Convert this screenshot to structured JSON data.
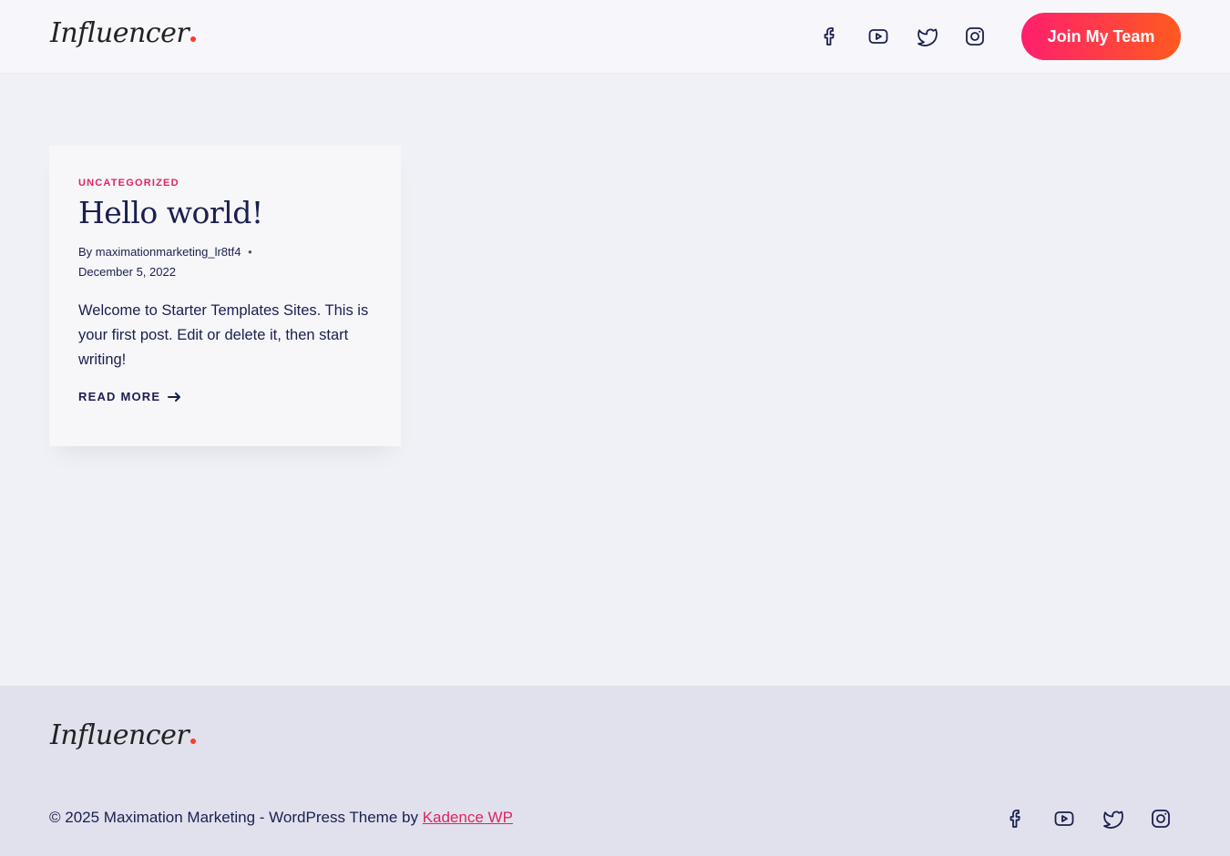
{
  "colors": {
    "accent": "#e0245e",
    "navy": "#1a1f4f",
    "button_gradient_start": "#ff1f6d",
    "button_gradient_end": "#ff5a1f",
    "logo_dot": "#ff3d1f"
  },
  "header": {
    "logo_text": "Influencer",
    "social_icons": [
      "facebook-icon",
      "youtube-icon",
      "twitter-icon",
      "instagram-icon"
    ],
    "cta_label": "Join My Team"
  },
  "post": {
    "category": "UNCATEGORIZED",
    "title": "Hello world!",
    "author_prefix": "By",
    "author": "maximationmarketing_lr8tf4",
    "date": "December 5, 2022",
    "excerpt": "Welcome to Starter Templates Sites. This is your first post. Edit or delete it, then start writing!",
    "read_more": "READ MORE"
  },
  "footer": {
    "logo_text": "Influencer",
    "copyright": "© 2025 Maximation Marketing - WordPress Theme by",
    "theme_link": "Kadence WP",
    "social_icons": [
      "facebook-icon",
      "youtube-icon",
      "twitter-icon",
      "instagram-icon"
    ]
  }
}
